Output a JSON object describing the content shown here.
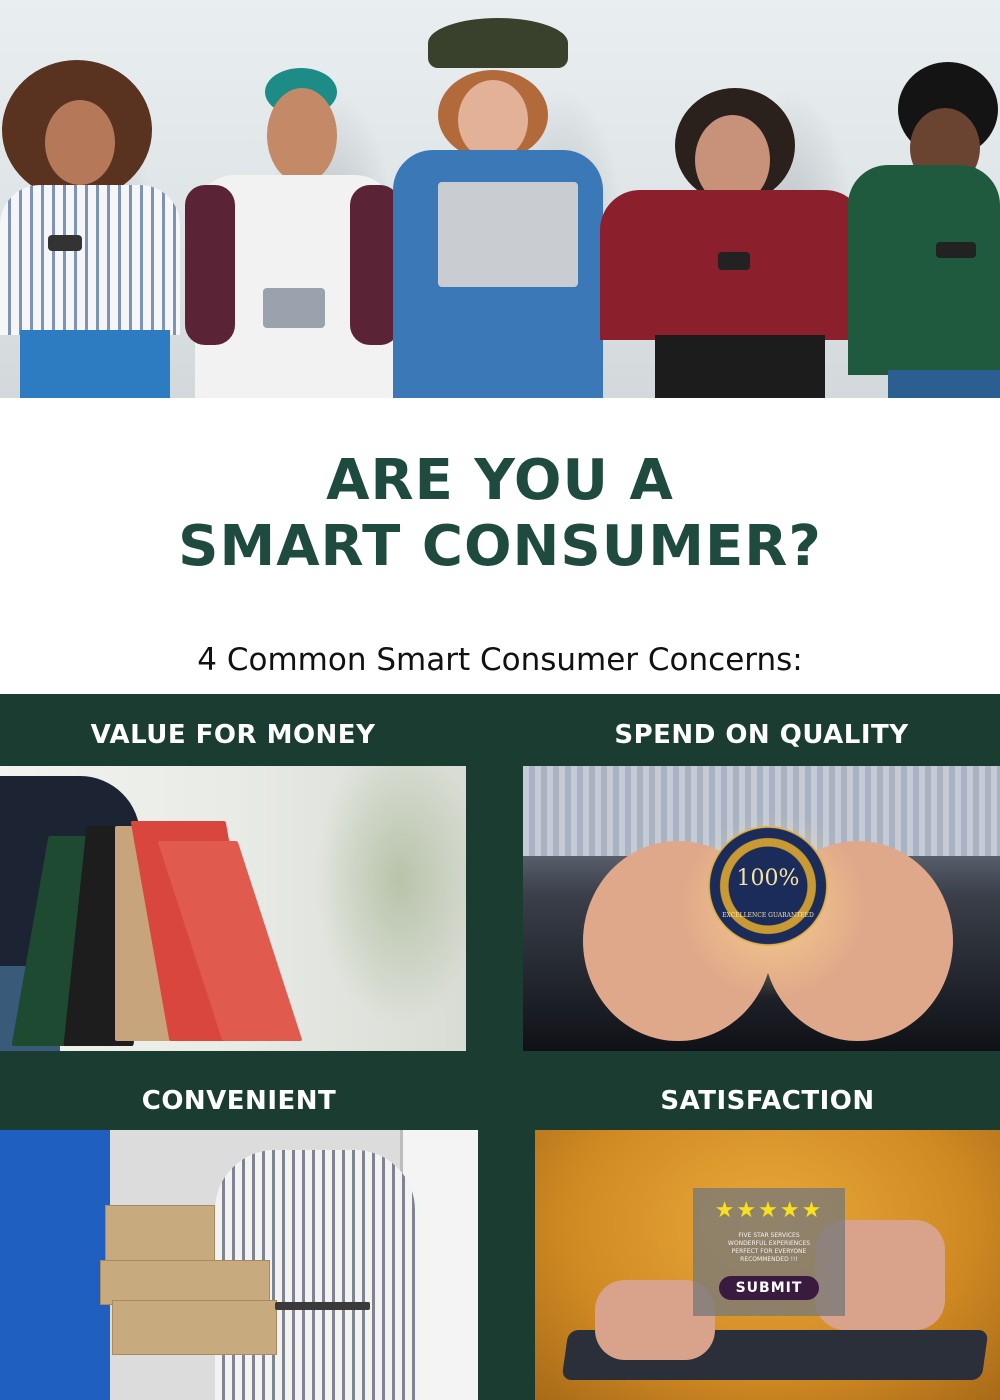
{
  "title": {
    "line1": "ARE YOU A",
    "line2": "SMART CONSUMER?"
  },
  "subtitle": "4 Common Smart Consumer Concerns:",
  "concerns": [
    {
      "label": "VALUE FOR MONEY",
      "image": "shopping-bags"
    },
    {
      "label": "SPEND ON QUALITY",
      "image": "hands-with-badge"
    },
    {
      "label": "CONVENIENT",
      "image": "package-delivery"
    },
    {
      "label": "SATISFACTION",
      "image": "rating-on-tablet"
    }
  ],
  "badge": {
    "value": "100%",
    "text": "EXCELLENCE GUARANTEED"
  },
  "rating_card": {
    "stars": "★★★★★",
    "lines": [
      "FIVE STAR SERVICES",
      "WONDERFUL EXPERIENCES",
      "PERFECT FOR EVERYONE",
      "RECOMMENDED !!!"
    ],
    "button": "SUBMIT"
  },
  "colors": {
    "heading": "#1e4a3f",
    "panel": "#1b3d31",
    "label": "#ffffff",
    "star": "#f6e020"
  }
}
